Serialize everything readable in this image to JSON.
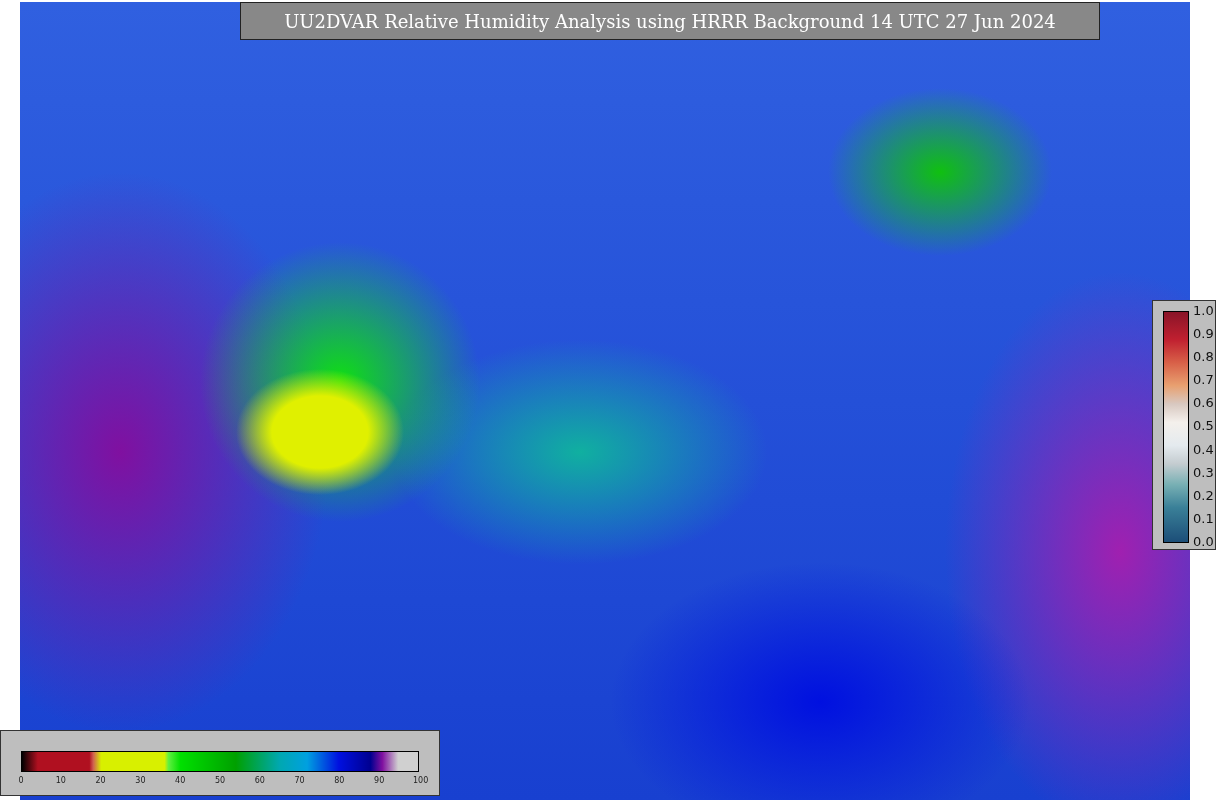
{
  "title": "UU2DVAR Relative Humidity Analysis using HRRR Background 14 UTC 27 Jun 2024",
  "humidity_colorbar": {
    "ticks": [
      "0",
      "10",
      "20",
      "30",
      "40",
      "50",
      "60",
      "70",
      "80",
      "90",
      "100"
    ]
  },
  "observation_legend": {
    "ticks": [
      "1.0",
      "0.9",
      "0.8",
      "0.7",
      "0.6",
      "0.5",
      "0.4",
      "0.3",
      "0.2",
      "0.1",
      "0.0"
    ]
  }
}
